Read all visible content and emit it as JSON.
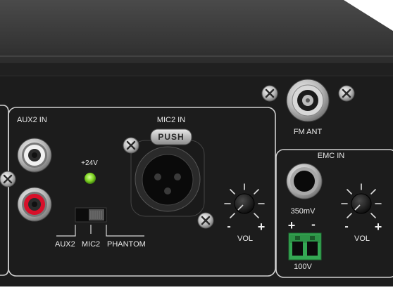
{
  "labels": {
    "aux2_in": "AUX2  IN",
    "mic2_in": "MIC2  IN",
    "push": "PUSH",
    "led_24v": "+24V",
    "sw_aux2": "AUX2",
    "sw_mic2": "MIC2",
    "sw_phantom": "PHANTOM",
    "vol": "VOL",
    "fm_ant": "FM ANT",
    "emc_in": "EMC IN",
    "sens_350mv": "350mV",
    "v100": "100V",
    "plus": "+",
    "minus": "-"
  },
  "colors": {
    "panel": "#1c1c1c",
    "top_surface": "#383838",
    "section_border": "#d0d0d0",
    "led_green": "#7ed321",
    "rca_red": "#d8102a",
    "rca_white": "#f0f0f0",
    "terminal_green": "#34a853"
  },
  "icons": [
    "screw-icon",
    "rca-jack",
    "xlr-jack",
    "knob",
    "dip-switch",
    "phono-jack",
    "coax-connector",
    "terminal-block",
    "led-indicator"
  ]
}
